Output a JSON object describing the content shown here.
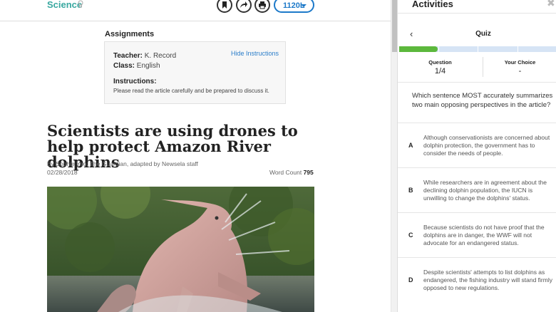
{
  "header": {
    "subject": "Science",
    "lexile": "1120L"
  },
  "assignments": {
    "title": "Assignments",
    "teacher_label": "Teacher:",
    "teacher_value": "K. Record",
    "class_label": "Class:",
    "class_value": "English",
    "hide_link": "Hide Instructions",
    "instructions_label": "Instructions:",
    "instructions_text": "Please read the article carefully and be prepared to discuss it."
  },
  "article": {
    "headline": "Scientists are using drones to help protect Amazon River dolphins",
    "byline": "By Sophie Yeo, The Guardian, adapted by Newsela staff",
    "date": "02/28/2018",
    "word_count_label": "Word Count",
    "word_count": "795",
    "photo_subject": "river-dolphin-photo"
  },
  "activities": {
    "title": "Activities",
    "close": "✖",
    "quiz_title": "Quiz",
    "back": "‹",
    "progress_fraction": 0.25,
    "progress_segments": 4,
    "question_label": "Question",
    "question_value": "1/4",
    "choice_label": "Your Choice",
    "choice_value": "-",
    "question_text": "Which sentence MOST accurately summarizes two main opposing perspectives in the article?",
    "answers": [
      {
        "letter": "A",
        "text": "Although conservationists are concerned about dolphin protection, the government has to consider the needs of people."
      },
      {
        "letter": "B",
        "text": "While researchers are in agreement about the declining dolphin population, the IUCN is unwilling to change the dolphins' status."
      },
      {
        "letter": "C",
        "text": "Because scientists do not have proof that the dolphins are in danger, the WWF will not advocate for an endangered status."
      },
      {
        "letter": "D",
        "text": "Despite scientists' attempts to list dolphins as endangered, the fishing industry will stand firmly opposed to new regulations."
      }
    ]
  },
  "colors": {
    "subject": "#39a8a0",
    "accent": "#1c79c9",
    "progress_done": "#5cb83c",
    "progress_todo": "#d6e4f5"
  }
}
